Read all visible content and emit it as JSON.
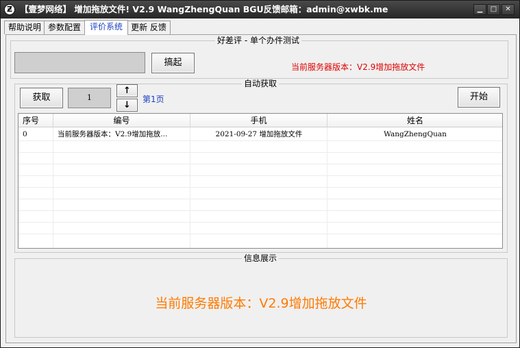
{
  "window": {
    "title": "【壹梦网络】 增加拖放文件! V2.9 WangZhengQuan BGU反馈邮箱：admin@xwbk.me",
    "icon": "app-logo-icon",
    "controls": {
      "minimize": "□",
      "restore": "□",
      "close": "✕"
    }
  },
  "tabs": [
    {
      "label": "帮助说明"
    },
    {
      "label": "参数配置"
    },
    {
      "label": "评价系统"
    },
    {
      "label": "更新 反馈"
    }
  ],
  "single_test": {
    "legend": "好差评 - 单个办件测试",
    "input_value": "",
    "button_label": "搞起",
    "version_text": "当前服务器版本：V2.9增加拖放文件"
  },
  "auto_fetch": {
    "legend": "自动获取",
    "fetch_button": "获取",
    "page_value": "1",
    "up_arrow": "↑",
    "down_arrow": "↓",
    "page_label": "第1页",
    "start_button": "开始"
  },
  "table": {
    "columns": [
      "序号",
      "编号",
      "手机",
      "姓名"
    ],
    "rows": [
      [
        "0",
        "当前服务器版本：V2.9增加拖放...",
        "2021-09-27 增加拖放文件",
        "WangZhengQuan"
      ]
    ]
  },
  "info": {
    "legend": "信息展示",
    "message": "当前服务器版本：V2.9增加拖放文件"
  },
  "colors": {
    "accent_red": "#e00000",
    "message_orange": "#ff7a00",
    "active_tab": "#1a3fbf"
  }
}
